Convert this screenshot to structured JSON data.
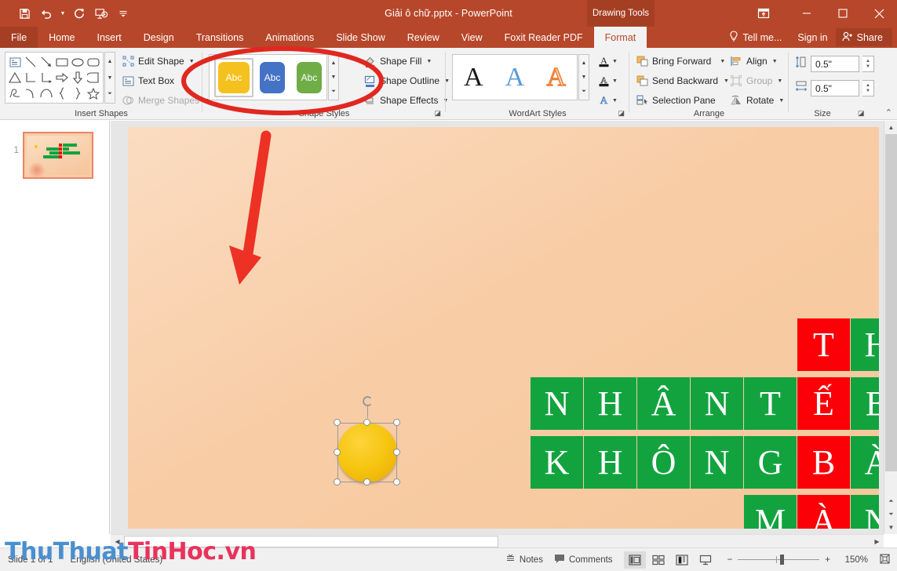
{
  "app": {
    "title": "Giải ô chữ.pptx - PowerPoint",
    "contextual_tools": "Drawing Tools"
  },
  "quick_access": [
    {
      "name": "save-icon",
      "label": "Save"
    },
    {
      "name": "undo-icon",
      "label": "Undo"
    },
    {
      "name": "redo-icon",
      "label": "Redo"
    },
    {
      "name": "start-slideshow-icon",
      "label": "Start From Beginning"
    },
    {
      "name": "customize-qat-icon",
      "label": "Customize Quick Access Toolbar"
    }
  ],
  "window_controls": {
    "ribbon_display": "Ribbon Display Options",
    "minimize": "Minimize",
    "restore": "Restore Down",
    "close": "Close"
  },
  "tabs": [
    {
      "label": "File",
      "state": "file"
    },
    {
      "label": "Home",
      "state": "normal"
    },
    {
      "label": "Insert",
      "state": "normal"
    },
    {
      "label": "Design",
      "state": "normal"
    },
    {
      "label": "Transitions",
      "state": "normal"
    },
    {
      "label": "Animations",
      "state": "normal"
    },
    {
      "label": "Slide Show",
      "state": "normal"
    },
    {
      "label": "Review",
      "state": "normal"
    },
    {
      "label": "View",
      "state": "normal"
    },
    {
      "label": "Foxit Reader PDF",
      "state": "normal"
    },
    {
      "label": "Format",
      "state": "active"
    }
  ],
  "tabbar_right": {
    "tell_me": "Tell me...",
    "sign_in": "Sign in",
    "share": "Share"
  },
  "ribbon": {
    "groups": [
      {
        "label": "Insert Shapes"
      },
      {
        "label": "Shape Styles"
      },
      {
        "label": "WordArt Styles"
      },
      {
        "label": "Arrange"
      },
      {
        "label": "Size"
      }
    ],
    "insert_shapes": {
      "commands": [
        {
          "label": "Edit Shape",
          "icon": "edit-shape-icon",
          "dropdown": true,
          "disabled": false
        },
        {
          "label": "Text Box",
          "icon": "text-box-icon",
          "dropdown": false,
          "disabled": false
        },
        {
          "label": "Merge Shapes",
          "icon": "merge-shapes-icon",
          "dropdown": true,
          "disabled": true
        }
      ]
    },
    "shape_styles": {
      "thumbs": [
        {
          "label": "Abc",
          "color": "#f5c11e",
          "selected": true
        },
        {
          "label": "Abc",
          "color": "#4472c4",
          "selected": false
        },
        {
          "label": "Abc",
          "color": "#70ad47",
          "selected": false
        }
      ],
      "commands": [
        {
          "label": "Shape Fill",
          "icon": "shape-fill-icon",
          "dropdown": true
        },
        {
          "label": "Shape Outline",
          "icon": "shape-outline-icon",
          "dropdown": true
        },
        {
          "label": "Shape Effects",
          "icon": "shape-effects-icon",
          "dropdown": true
        }
      ]
    },
    "wordart_styles": {
      "thumbs": [
        {
          "label": "A",
          "color": "#1a1a1a"
        },
        {
          "label": "A",
          "color": "#5b9bd5"
        },
        {
          "label": "A",
          "color": "#ed7d31"
        }
      ],
      "commands": [
        {
          "label": "Text Fill",
          "icon": "text-fill-icon"
        },
        {
          "label": "Text Outline",
          "icon": "text-outline-icon"
        },
        {
          "label": "Text Effects",
          "icon": "text-effects-icon"
        }
      ]
    },
    "arrange": {
      "commands": [
        {
          "label": "Bring Forward",
          "icon": "bring-forward-icon",
          "dropdown": true,
          "disabled": false
        },
        {
          "label": "Send Backward",
          "icon": "send-backward-icon",
          "dropdown": true,
          "disabled": false
        },
        {
          "label": "Selection Pane",
          "icon": "selection-pane-icon",
          "dropdown": false,
          "disabled": false
        },
        {
          "label": "Align",
          "icon": "align-icon",
          "dropdown": true,
          "disabled": false
        },
        {
          "label": "Group",
          "icon": "group-icon",
          "dropdown": true,
          "disabled": true
        },
        {
          "label": "Rotate",
          "icon": "rotate-icon",
          "dropdown": true,
          "disabled": false
        }
      ]
    },
    "size": {
      "height": {
        "label": "Shape Height",
        "value": "0.5\""
      },
      "width": {
        "label": "Shape Width",
        "value": "0.5\""
      }
    },
    "collapse": "Collapse the Ribbon"
  },
  "thumbnails": [
    {
      "number": "1"
    }
  ],
  "slide": {
    "background": "#f8cda6",
    "selected_shape": {
      "name": "oval",
      "fill": "#f6c611",
      "handles": 8,
      "rotation_handle": true
    },
    "crossword": {
      "colors": {
        "green": "#12a33f",
        "red": "#fb0007"
      },
      "cells": [
        {
          "row": 0,
          "col": 5,
          "letter": "T",
          "color": "red"
        },
        {
          "row": 0,
          "col": 6,
          "letter": "H",
          "color": "green"
        },
        {
          "row": 1,
          "col": 0,
          "letter": "N",
          "color": "green"
        },
        {
          "row": 1,
          "col": 1,
          "letter": "H",
          "color": "green"
        },
        {
          "row": 1,
          "col": 2,
          "letter": "Â",
          "color": "green"
        },
        {
          "row": 1,
          "col": 3,
          "letter": "N",
          "color": "green"
        },
        {
          "row": 1,
          "col": 4,
          "letter": "T",
          "color": "green"
        },
        {
          "row": 1,
          "col": 5,
          "letter": "Ế",
          "color": "red"
        },
        {
          "row": 1,
          "col": 6,
          "letter": "B",
          "color": "green"
        },
        {
          "row": 2,
          "col": 0,
          "letter": "K",
          "color": "green"
        },
        {
          "row": 2,
          "col": 1,
          "letter": "H",
          "color": "green"
        },
        {
          "row": 2,
          "col": 2,
          "letter": "Ô",
          "color": "green"
        },
        {
          "row": 2,
          "col": 3,
          "letter": "N",
          "color": "green"
        },
        {
          "row": 2,
          "col": 4,
          "letter": "G",
          "color": "green"
        },
        {
          "row": 2,
          "col": 5,
          "letter": "B",
          "color": "red"
        },
        {
          "row": 2,
          "col": 6,
          "letter": "À",
          "color": "green"
        },
        {
          "row": 3,
          "col": 4,
          "letter": "M",
          "color": "green"
        },
        {
          "row": 3,
          "col": 5,
          "letter": "À",
          "color": "red"
        },
        {
          "row": 3,
          "col": 6,
          "letter": "N",
          "color": "green"
        }
      ]
    },
    "annotations": [
      {
        "name": "red-arrow-annotation",
        "color": "#ed3124"
      },
      {
        "name": "red-ellipse-annotation",
        "color": "#e02720"
      }
    ]
  },
  "status_bar": {
    "slide_indicator": "Slide 1 of 1",
    "language": "English (United States)",
    "notes": "Notes",
    "comments": "Comments",
    "views": [
      {
        "name": "normal-view-button",
        "active": true
      },
      {
        "name": "slide-sorter-view-button",
        "active": false
      },
      {
        "name": "reading-view-button",
        "active": false
      },
      {
        "name": "slideshow-view-button",
        "active": false
      }
    ],
    "zoom_out": "−",
    "zoom_in": "+",
    "zoom_level": "150%",
    "fit_slide": "Fit slide to current window"
  },
  "watermark": {
    "part1": "ThuThuat",
    "part2": "TinHoc.vn",
    "color1": "#4a8fd0",
    "color2": "#e8335c"
  }
}
